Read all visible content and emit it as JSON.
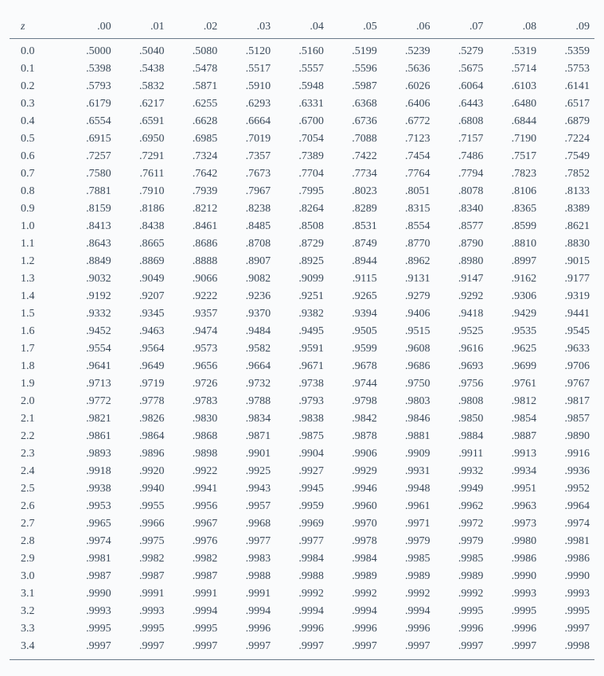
{
  "header": {
    "z": "z",
    "cols": [
      ".00",
      ".01",
      ".02",
      ".03",
      ".04",
      ".05",
      ".06",
      ".07",
      ".08",
      ".09"
    ]
  },
  "rows": [
    {
      "z": "0.0",
      "v": [
        ".5000",
        ".5040",
        ".5080",
        ".5120",
        ".5160",
        ".5199",
        ".5239",
        ".5279",
        ".5319",
        ".5359"
      ]
    },
    {
      "z": "0.1",
      "v": [
        ".5398",
        ".5438",
        ".5478",
        ".5517",
        ".5557",
        ".5596",
        ".5636",
        ".5675",
        ".5714",
        ".5753"
      ]
    },
    {
      "z": "0.2",
      "v": [
        ".5793",
        ".5832",
        ".5871",
        ".5910",
        ".5948",
        ".5987",
        ".6026",
        ".6064",
        ".6103",
        ".6141"
      ]
    },
    {
      "z": "0.3",
      "v": [
        ".6179",
        ".6217",
        ".6255",
        ".6293",
        ".6331",
        ".6368",
        ".6406",
        ".6443",
        ".6480",
        ".6517"
      ]
    },
    {
      "z": "0.4",
      "v": [
        ".6554",
        ".6591",
        ".6628",
        ".6664",
        ".6700",
        ".6736",
        ".6772",
        ".6808",
        ".6844",
        ".6879"
      ]
    },
    {
      "z": "0.5",
      "v": [
        ".6915",
        ".6950",
        ".6985",
        ".7019",
        ".7054",
        ".7088",
        ".7123",
        ".7157",
        ".7190",
        ".7224"
      ]
    },
    {
      "z": "0.6",
      "v": [
        ".7257",
        ".7291",
        ".7324",
        ".7357",
        ".7389",
        ".7422",
        ".7454",
        ".7486",
        ".7517",
        ".7549"
      ]
    },
    {
      "z": "0.7",
      "v": [
        ".7580",
        ".7611",
        ".7642",
        ".7673",
        ".7704",
        ".7734",
        ".7764",
        ".7794",
        ".7823",
        ".7852"
      ]
    },
    {
      "z": "0.8",
      "v": [
        ".7881",
        ".7910",
        ".7939",
        ".7967",
        ".7995",
        ".8023",
        ".8051",
        ".8078",
        ".8106",
        ".8133"
      ]
    },
    {
      "z": "0.9",
      "v": [
        ".8159",
        ".8186",
        ".8212",
        ".8238",
        ".8264",
        ".8289",
        ".8315",
        ".8340",
        ".8365",
        ".8389"
      ]
    },
    {
      "z": "1.0",
      "v": [
        ".8413",
        ".8438",
        ".8461",
        ".8485",
        ".8508",
        ".8531",
        ".8554",
        ".8577",
        ".8599",
        ".8621"
      ]
    },
    {
      "z": "1.1",
      "v": [
        ".8643",
        ".8665",
        ".8686",
        ".8708",
        ".8729",
        ".8749",
        ".8770",
        ".8790",
        ".8810",
        ".8830"
      ]
    },
    {
      "z": "1.2",
      "v": [
        ".8849",
        ".8869",
        ".8888",
        ".8907",
        ".8925",
        ".8944",
        ".8962",
        ".8980",
        ".8997",
        ".9015"
      ]
    },
    {
      "z": "1.3",
      "v": [
        ".9032",
        ".9049",
        ".9066",
        ".9082",
        ".9099",
        ".9115",
        ".9131",
        ".9147",
        ".9162",
        ".9177"
      ]
    },
    {
      "z": "1.4",
      "v": [
        ".9192",
        ".9207",
        ".9222",
        ".9236",
        ".9251",
        ".9265",
        ".9279",
        ".9292",
        ".9306",
        ".9319"
      ]
    },
    {
      "z": "1.5",
      "v": [
        ".9332",
        ".9345",
        ".9357",
        ".9370",
        ".9382",
        ".9394",
        ".9406",
        ".9418",
        ".9429",
        ".9441"
      ]
    },
    {
      "z": "1.6",
      "v": [
        ".9452",
        ".9463",
        ".9474",
        ".9484",
        ".9495",
        ".9505",
        ".9515",
        ".9525",
        ".9535",
        ".9545"
      ]
    },
    {
      "z": "1.7",
      "v": [
        ".9554",
        ".9564",
        ".9573",
        ".9582",
        ".9591",
        ".9599",
        ".9608",
        ".9616",
        ".9625",
        ".9633"
      ]
    },
    {
      "z": "1.8",
      "v": [
        ".9641",
        ".9649",
        ".9656",
        ".9664",
        ".9671",
        ".9678",
        ".9686",
        ".9693",
        ".9699",
        ".9706"
      ]
    },
    {
      "z": "1.9",
      "v": [
        ".9713",
        ".9719",
        ".9726",
        ".9732",
        ".9738",
        ".9744",
        ".9750",
        ".9756",
        ".9761",
        ".9767"
      ]
    },
    {
      "z": "2.0",
      "v": [
        ".9772",
        ".9778",
        ".9783",
        ".9788",
        ".9793",
        ".9798",
        ".9803",
        ".9808",
        ".9812",
        ".9817"
      ]
    },
    {
      "z": "2.1",
      "v": [
        ".9821",
        ".9826",
        ".9830",
        ".9834",
        ".9838",
        ".9842",
        ".9846",
        ".9850",
        ".9854",
        ".9857"
      ]
    },
    {
      "z": "2.2",
      "v": [
        ".9861",
        ".9864",
        ".9868",
        ".9871",
        ".9875",
        ".9878",
        ".9881",
        ".9884",
        ".9887",
        ".9890"
      ]
    },
    {
      "z": "2.3",
      "v": [
        ".9893",
        ".9896",
        ".9898",
        ".9901",
        ".9904",
        ".9906",
        ".9909",
        ".9911",
        ".9913",
        ".9916"
      ]
    },
    {
      "z": "2.4",
      "v": [
        ".9918",
        ".9920",
        ".9922",
        ".9925",
        ".9927",
        ".9929",
        ".9931",
        ".9932",
        ".9934",
        ".9936"
      ]
    },
    {
      "z": "2.5",
      "v": [
        ".9938",
        ".9940",
        ".9941",
        ".9943",
        ".9945",
        ".9946",
        ".9948",
        ".9949",
        ".9951",
        ".9952"
      ]
    },
    {
      "z": "2.6",
      "v": [
        ".9953",
        ".9955",
        ".9956",
        ".9957",
        ".9959",
        ".9960",
        ".9961",
        ".9962",
        ".9963",
        ".9964"
      ]
    },
    {
      "z": "2.7",
      "v": [
        ".9965",
        ".9966",
        ".9967",
        ".9968",
        ".9969",
        ".9970",
        ".9971",
        ".9972",
        ".9973",
        ".9974"
      ]
    },
    {
      "z": "2.8",
      "v": [
        ".9974",
        ".9975",
        ".9976",
        ".9977",
        ".9977",
        ".9978",
        ".9979",
        ".9979",
        ".9980",
        ".9981"
      ]
    },
    {
      "z": "2.9",
      "v": [
        ".9981",
        ".9982",
        ".9982",
        ".9983",
        ".9984",
        ".9984",
        ".9985",
        ".9985",
        ".9986",
        ".9986"
      ]
    },
    {
      "z": "3.0",
      "v": [
        ".9987",
        ".9987",
        ".9987",
        ".9988",
        ".9988",
        ".9989",
        ".9989",
        ".9989",
        ".9990",
        ".9990"
      ]
    },
    {
      "z": "3.1",
      "v": [
        ".9990",
        ".9991",
        ".9991",
        ".9991",
        ".9992",
        ".9992",
        ".9992",
        ".9992",
        ".9993",
        ".9993"
      ]
    },
    {
      "z": "3.2",
      "v": [
        ".9993",
        ".9993",
        ".9994",
        ".9994",
        ".9994",
        ".9994",
        ".9994",
        ".9995",
        ".9995",
        ".9995"
      ]
    },
    {
      "z": "3.3",
      "v": [
        ".9995",
        ".9995",
        ".9995",
        ".9996",
        ".9996",
        ".9996",
        ".9996",
        ".9996",
        ".9996",
        ".9997"
      ]
    },
    {
      "z": "3.4",
      "v": [
        ".9997",
        ".9997",
        ".9997",
        ".9997",
        ".9997",
        ".9997",
        ".9997",
        ".9997",
        ".9997",
        ".9998"
      ]
    }
  ]
}
